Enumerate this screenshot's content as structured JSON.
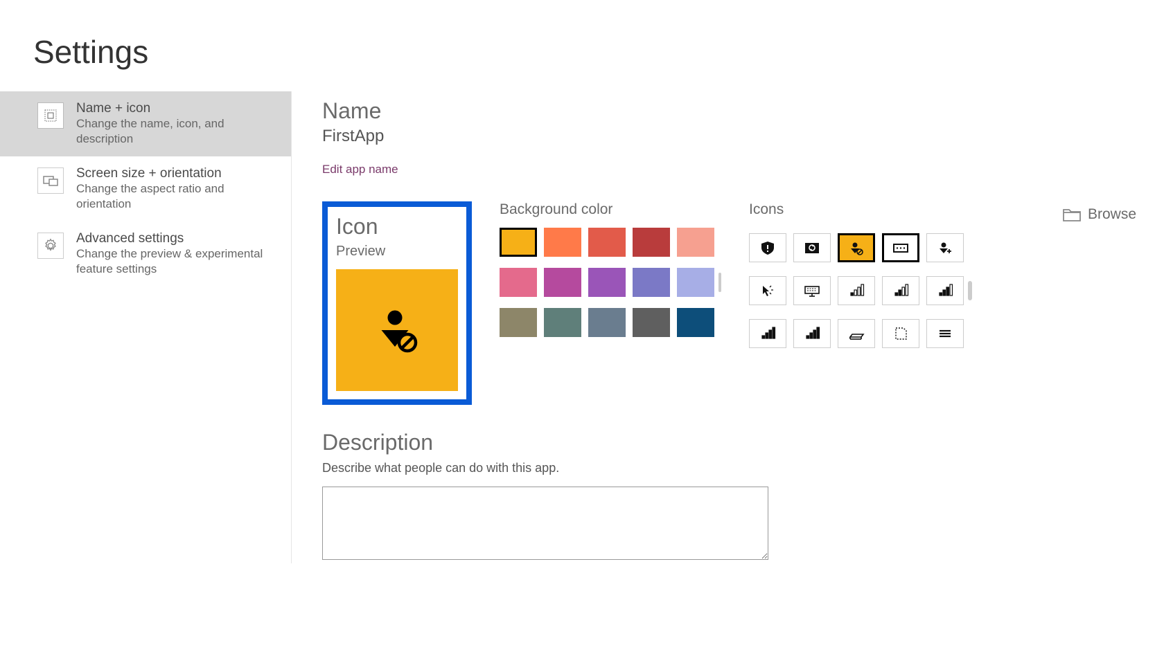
{
  "page": {
    "title": "Settings"
  },
  "sidebar": {
    "items": [
      {
        "title": "Name + icon",
        "sub": "Change the name, icon, and description"
      },
      {
        "title": "Screen size + orientation",
        "sub": "Change the aspect ratio and orientation"
      },
      {
        "title": "Advanced settings",
        "sub": "Change the preview & experimental feature settings"
      }
    ]
  },
  "name": {
    "label": "Name",
    "value": "FirstApp",
    "edit_link": "Edit app name"
  },
  "icon": {
    "label": "Icon",
    "preview_label": "Preview",
    "bg_label": "Background color",
    "icons_label": "Icons",
    "browse_label": "Browse",
    "colors": [
      {
        "hex": "#f6b017",
        "selected": true
      },
      {
        "hex": "#ff7a49"
      },
      {
        "hex": "#e25b4a"
      },
      {
        "hex": "#b93c3c"
      },
      {
        "hex": "#f6a090"
      },
      {
        "hex": "#e46a8c"
      },
      {
        "hex": "#b54a9e"
      },
      {
        "hex": "#9a55b8"
      },
      {
        "hex": "#7b79c6"
      },
      {
        "hex": "#a7aee6"
      },
      {
        "hex": "#8d8669"
      },
      {
        "hex": "#5f7f7a"
      },
      {
        "hex": "#6a7d8f"
      },
      {
        "hex": "#5f5f5f"
      },
      {
        "hex": "#0d4e7a"
      }
    ],
    "icons": [
      {
        "name": "shield-alert-icon"
      },
      {
        "name": "photo-sync-icon"
      },
      {
        "name": "user-block-icon",
        "selected": true
      },
      {
        "name": "card-icon",
        "alt_selected": true
      },
      {
        "name": "user-add-icon"
      },
      {
        "name": "pointer-icon"
      },
      {
        "name": "keyboard-icon"
      },
      {
        "name": "signal-1-icon"
      },
      {
        "name": "signal-2-icon"
      },
      {
        "name": "signal-3-icon"
      },
      {
        "name": "signal-4-icon"
      },
      {
        "name": "signal-5-icon"
      },
      {
        "name": "scanner-icon"
      },
      {
        "name": "page-dashed-icon"
      },
      {
        "name": "menu-icon"
      }
    ]
  },
  "description": {
    "label": "Description",
    "sub": "Describe what people can do with this app.",
    "value": ""
  }
}
